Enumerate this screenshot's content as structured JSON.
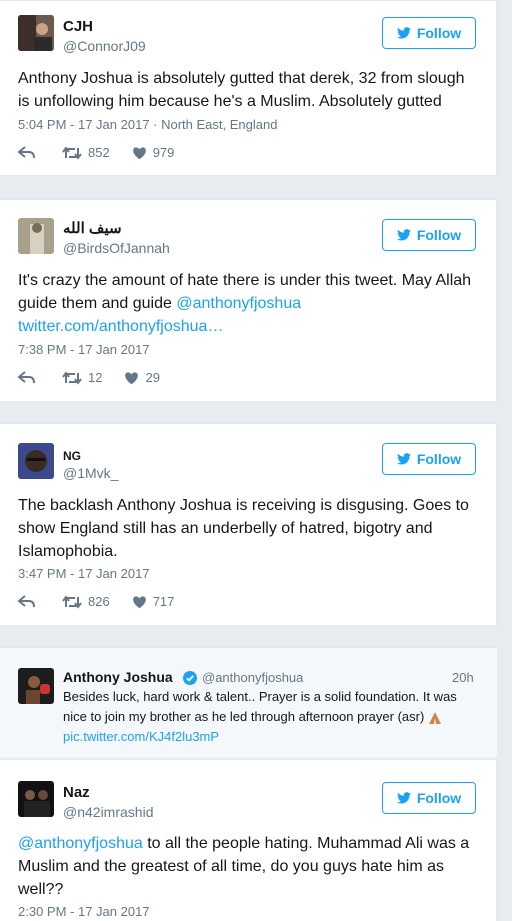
{
  "tweets": [
    {
      "name": "CJH",
      "handle": "@ConnorJ09",
      "follow_label": "Follow",
      "text": "Anthony Joshua is absolutely gutted that derek, 32 from slough is unfollowing him because he's a Muslim. Absolutely gutted",
      "timestamp": "5:04 PM - 17 Jan 2017 · North East, England",
      "retweets": "852",
      "likes": "979"
    },
    {
      "name": "سيف الله",
      "handle": "@BirdsOfJannah",
      "follow_label": "Follow",
      "text_prefix": "It's crazy the amount of hate there is under this tweet. May Allah guide them and guide ",
      "mention": "@anthonyfjoshua",
      "link": "twitter.com/anthonyfjoshua…",
      "timestamp": "7:38 PM - 17 Jan 2017",
      "retweets": "12",
      "likes": "29"
    },
    {
      "name": "NG",
      "handle": "@1Mvk_",
      "follow_label": "Follow",
      "text": "The backlash Anthony Joshua is receiving is disgusing. Goes to show England still has an underbelly of hatred, bigotry and Islamophobia.",
      "timestamp": "3:47 PM - 17 Jan 2017",
      "retweets": "826",
      "likes": "717"
    }
  ],
  "quoted": {
    "name": "Anthony Joshua",
    "handle": "@anthonyfjoshua",
    "time": "20h",
    "text": "Besides luck, hard work & talent.. Prayer is a solid foundation. It was nice to join my brother as he led through afternoon prayer (asr) ",
    "link": "pic.twitter.com/KJ4f2lu3mP"
  },
  "last_tweet": {
    "name": "Naz",
    "handle": "@n42imrashid",
    "follow_label": "Follow",
    "mention": "@anthonyfjoshua",
    "text_suffix": " to all the people hating. Muhammad Ali was a Muslim and the greatest of all time, do you guys hate him as well??",
    "timestamp": "2:30 PM - 17 Jan 2017"
  },
  "colors": {
    "accent": "#1da1f2",
    "muted": "#657786",
    "background": "#e6ecf0"
  }
}
